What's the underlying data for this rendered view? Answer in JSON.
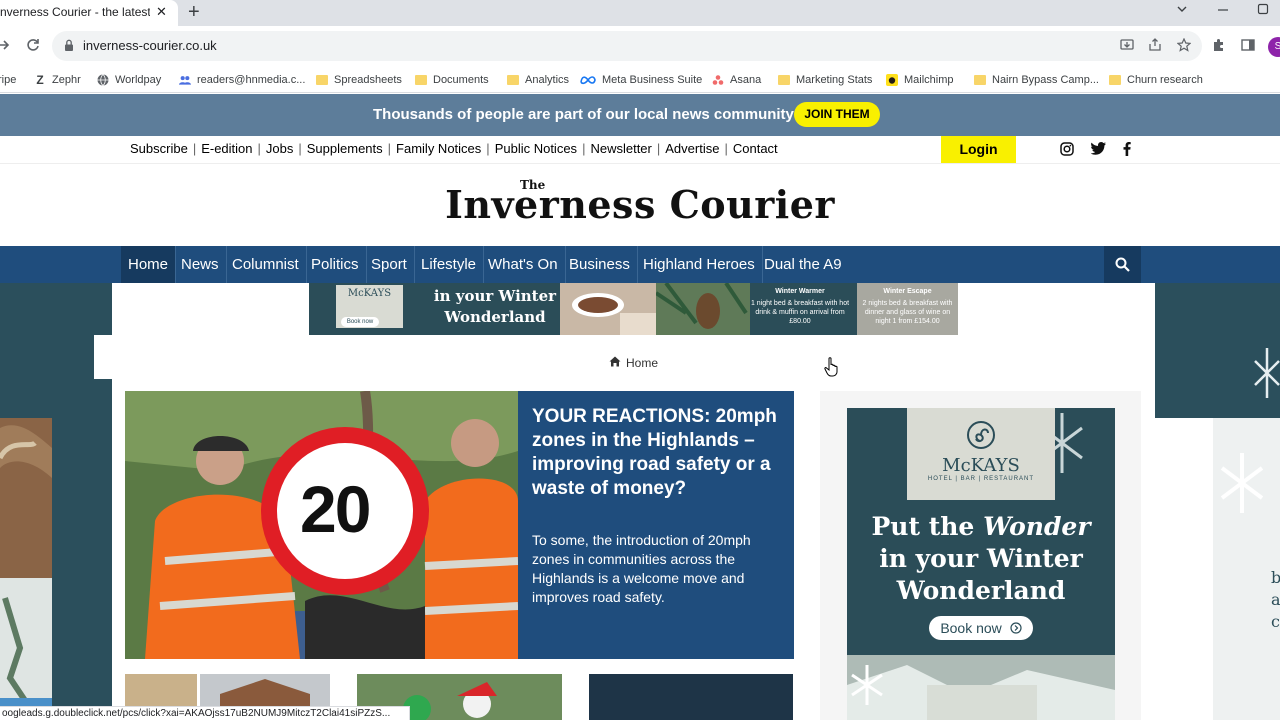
{
  "browser": {
    "tab_title": "nverness Courier - the latest Ne",
    "tab_close": "✕",
    "new_tab": "+",
    "url": "inverness-courier.co.uk",
    "profile_initial": "S",
    "bookmarks": [
      {
        "label": "ripe",
        "icon": "none"
      },
      {
        "label": "Zephr",
        "icon": "zephr-icon"
      },
      {
        "label": "Worldpay",
        "icon": "globe-icon"
      },
      {
        "label": "readers@hnmedia.c...",
        "icon": "people-icon"
      },
      {
        "label": "Spreadsheets",
        "icon": "folder-icon"
      },
      {
        "label": "Documents",
        "icon": "folder-icon"
      },
      {
        "label": "Analytics",
        "icon": "folder-icon"
      },
      {
        "label": "Meta Business Suite",
        "icon": "meta-icon"
      },
      {
        "label": "Asana",
        "icon": "asana-icon"
      },
      {
        "label": "Marketing Stats",
        "icon": "folder-icon"
      },
      {
        "label": "Mailchimp",
        "icon": "mailchimp-icon"
      },
      {
        "label": "Nairn Bypass Camp...",
        "icon": "folder-icon"
      },
      {
        "label": "Churn research",
        "icon": "folder-icon"
      }
    ],
    "status_url": "ooglead​s.g.doubleclick.net/pcs/click?xai=AKAOjss17uB2NUMJ9MitczT2Clai41siPZzS..."
  },
  "site": {
    "banner_text": "Thousands of people are part of our local news community",
    "join_label": "JOIN THEM",
    "util_links": [
      "Subscribe",
      "E-edition",
      "Jobs",
      "Supplements",
      "Family Notices",
      "Public Notices",
      "Newsletter",
      "Advertise",
      "Contact"
    ],
    "login_label": "Login",
    "logo_small": "The",
    "logo": "Inverness Courier",
    "nav": [
      "Home",
      "News",
      "Columnist",
      "Politics",
      "Sport",
      "Lifestyle",
      "What's On",
      "Business",
      "Highland Heroes",
      "Dual the A9"
    ],
    "breadcrumb": "Home"
  },
  "leader_ad": {
    "brand": "McKAYS",
    "book": "Book now",
    "headline": "in your Winter Wonderland",
    "offer1_title": "Winter Warmer",
    "offer1_text": "1 night bed & breakfast with hot drink & muffin on arrival from £80.00",
    "offer2_title": "Winter Escape",
    "offer2_text": "2 nights bed & breakfast with dinner and glass of wine on night 1 from £154.00"
  },
  "hero": {
    "title": "YOUR REACTIONS: 20mph zones in the Highlands – improving road safety or a waste of money?",
    "summary": "To some, the introduction of 20mph zones in communities across the Highlands is a welcome move and improves road safety.",
    "sign_number": "20"
  },
  "side_ad": {
    "brand": "McKAYS",
    "brand_sub": "HOTEL | BAR | RESTAURANT",
    "headline_1": "Put the",
    "headline_em": "Wonder",
    "headline_2": "in your Winter",
    "headline_3": "Wonderland",
    "book": "Book now"
  },
  "colors": {
    "banner": "#5d7d9a",
    "nav": "#1f4d7d",
    "accent_yellow": "#f9f000",
    "ad_teal": "#2b4d58"
  }
}
